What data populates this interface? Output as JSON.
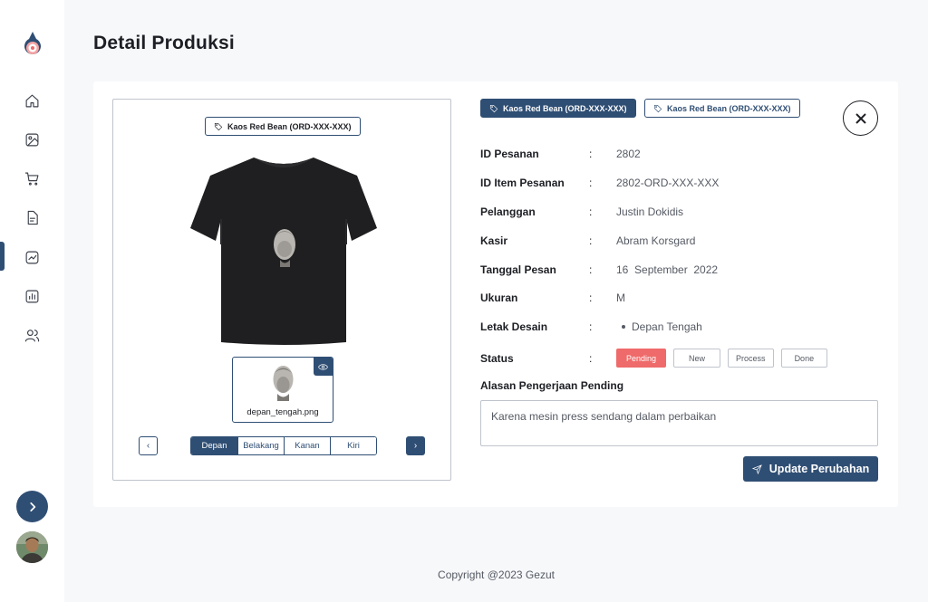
{
  "page": {
    "title": "Detail Produksi"
  },
  "sidebar": {
    "items": [
      {
        "icon": "home-icon"
      },
      {
        "icon": "image-icon"
      },
      {
        "icon": "cart-icon"
      },
      {
        "icon": "document-icon"
      },
      {
        "icon": "chart-trend-icon",
        "active": true
      },
      {
        "icon": "bar-chart-icon"
      },
      {
        "icon": "users-icon"
      }
    ]
  },
  "preview": {
    "tag_label": "Kaos Red Bean (ORD-XXX-XXX)",
    "thumbnail_name": "depan_tengah.png",
    "view_tabs": [
      "Depan",
      "Belakang",
      "Kanan",
      "Kiri"
    ],
    "active_view": "Depan",
    "prev_label": "‹",
    "next_label": "›"
  },
  "detail": {
    "tags": [
      "Kaos Red Bean (ORD-XXX-XXX)",
      "Kaos Red Bean (ORD-XXX-XXX)"
    ],
    "colon": ":",
    "fields": [
      {
        "label": "ID Pesanan",
        "value": "2802"
      },
      {
        "label": "ID Item Pesanan",
        "value": "2802-ORD-XXX-XXX"
      },
      {
        "label": "Pelanggan",
        "value": "Justin Dokidis"
      },
      {
        "label": "Kasir",
        "value": "Abram Korsgard"
      },
      {
        "label": "Tanggal Pesan",
        "value": "16  September  2022"
      },
      {
        "label": "Ukuran",
        "value": "M"
      },
      {
        "label": "Letak Desain",
        "value": "Depan Tengah"
      }
    ],
    "status_label": "Status",
    "statuses": [
      "Pending",
      "New",
      "Process",
      "Done"
    ],
    "active_status": "Pending",
    "reason_label": "Alasan Pengerjaan Pending",
    "reason_value": "Karena mesin press sendang dalam perbaikan",
    "update_button": "Update Perubahan"
  },
  "footer": {
    "text": "Copyright @2023 Gezut"
  },
  "colors": {
    "primary": "#2f4e74",
    "pending": "#ef6a6a",
    "border": "#bfc4cc"
  }
}
